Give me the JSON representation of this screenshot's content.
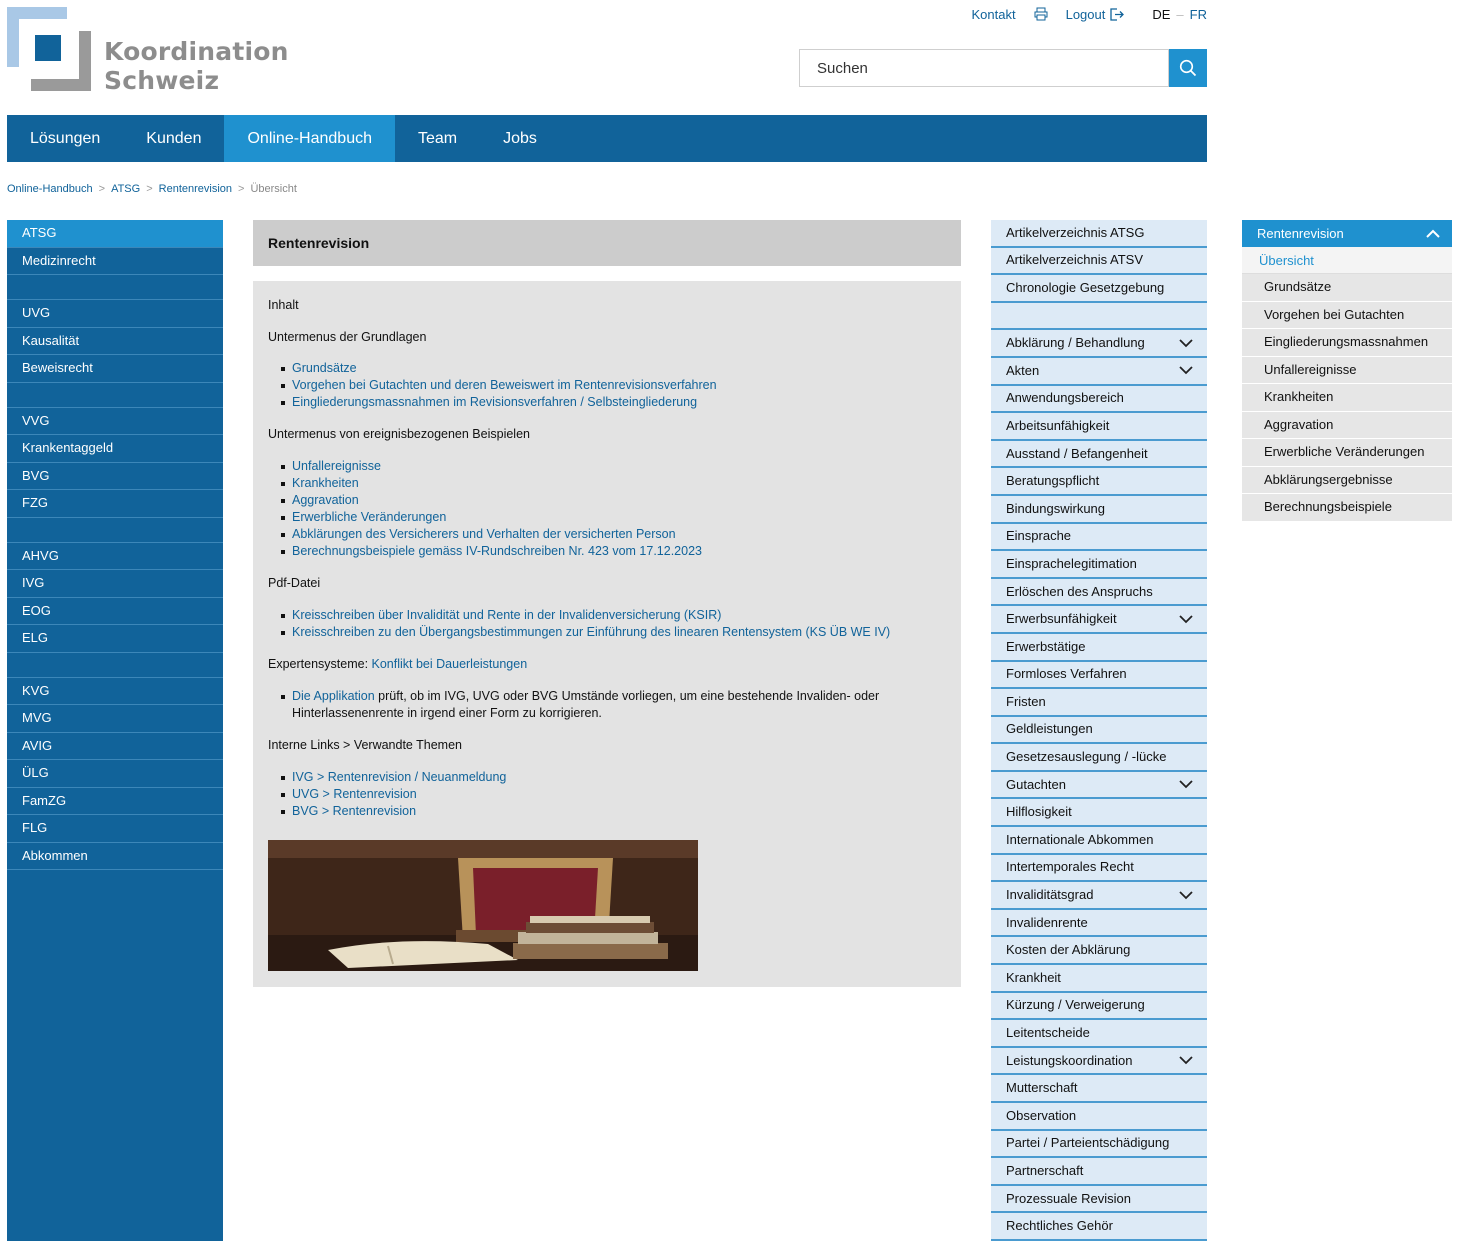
{
  "logo": {
    "line1": "Koordination",
    "line2": "Schweiz"
  },
  "topbar": {
    "contact": "Kontakt",
    "logout": "Logout",
    "lang_de": "DE",
    "lang_sep": "–",
    "lang_fr": "FR"
  },
  "search": {
    "placeholder": "Suchen"
  },
  "mainnav": [
    "Lösungen",
    "Kunden",
    "Online-Handbuch",
    "Team",
    "Jobs"
  ],
  "breadcrumb": {
    "b1": "Online-Handbuch",
    "b2": "ATSG",
    "b3": "Rentenrevision",
    "b4": "Übersicht",
    "sep": ">"
  },
  "leftnav": [
    "ATSG",
    "Medizinrecht",
    "",
    "UVG",
    "Kausalität",
    "Beweisrecht",
    "",
    "VVG",
    "Krankentaggeld",
    "BVG",
    "FZG",
    "",
    "AHVG",
    "IVG",
    "EOG",
    "ELG",
    "",
    "KVG",
    "MVG",
    "AVIG",
    "ÜLG",
    "FamZG",
    "FLG",
    "Abkommen"
  ],
  "content": {
    "title": "Rentenrevision",
    "inhalt": "Inhalt",
    "grundlagen_heading": "Untermenus der Grundlagen",
    "grundlagen": [
      "Grundsätze",
      "Vorgehen bei Gutachten und deren Beweiswert im Rentenrevisionsverfahren",
      "Eingliederungsmassnahmen im Revisionsverfahren / Selbsteingliederung"
    ],
    "beispiele_heading": "Untermenus von ereignisbezogenen Beispielen",
    "beispiele": [
      "Unfallereignisse",
      "Krankheiten",
      "Aggravation",
      "Erwerbliche Veränderungen",
      "Abklärungen des Versicherers und Verhalten der versicherten Person",
      "Berechnungsbeispiele gemäss IV-Rundschreiben Nr. 423 vom 17.12.2023"
    ],
    "pdf_heading": "Pdf-Datei",
    "pdf": [
      "Kreisschreiben über Invalidität und Rente in der Invalidenversicherung (KSIR)",
      "Kreisschreiben zu den Übergangsbestimmungen zur Einführung des linearen Rentensystem (KS ÜB WE IV)"
    ],
    "experten_label": "Expertensysteme: ",
    "experten_link": "Konflikt bei Dauerleistungen",
    "app_link": "Die Applikation",
    "app_text": " prüft, ob im IVG, UVG oder BVG Umstände vorliegen, um eine bestehende Invaliden- oder Hinterlassenenrente in irgend einer Form zu korrigieren.",
    "links_heading": "Interne Links > Verwandte Themen",
    "links": [
      "IVG > Rentenrevision / Neuanmeldung",
      "UVG > Rentenrevision",
      "BVG > Rentenrevision"
    ]
  },
  "artnav": [
    {
      "label": "Artikelverzeichnis ATSG",
      "chev": false
    },
    {
      "label": "Artikelverzeichnis ATSV",
      "chev": false
    },
    {
      "label": "Chronologie Gesetzgebung",
      "chev": false
    },
    {
      "label": "",
      "chev": false
    },
    {
      "label": "Abklärung / Behandlung",
      "chev": true
    },
    {
      "label": "Akten",
      "chev": true
    },
    {
      "label": "Anwendungsbereich",
      "chev": false
    },
    {
      "label": "Arbeitsunfähigkeit",
      "chev": false
    },
    {
      "label": "Ausstand / Befangenheit",
      "chev": false
    },
    {
      "label": "Beratungspflicht",
      "chev": false
    },
    {
      "label": "Bindungswirkung",
      "chev": false
    },
    {
      "label": "Einsprache",
      "chev": false
    },
    {
      "label": "Einsprachelegitimation",
      "chev": false
    },
    {
      "label": "Erlöschen des Anspruchs",
      "chev": false
    },
    {
      "label": "Erwerbsunfähigkeit",
      "chev": true
    },
    {
      "label": "Erwerbstätige",
      "chev": false
    },
    {
      "label": "Formloses Verfahren",
      "chev": false
    },
    {
      "label": "Fristen",
      "chev": false
    },
    {
      "label": "Geldleistungen",
      "chev": false
    },
    {
      "label": "Gesetzesauslegung / -lücke",
      "chev": false
    },
    {
      "label": "Gutachten",
      "chev": true
    },
    {
      "label": "Hilflosigkeit",
      "chev": false
    },
    {
      "label": "Internationale Abkommen",
      "chev": false
    },
    {
      "label": "Intertemporales Recht",
      "chev": false
    },
    {
      "label": "Invaliditätsgrad",
      "chev": true
    },
    {
      "label": "Invalidenrente",
      "chev": false
    },
    {
      "label": "Kosten der Abklärung",
      "chev": false
    },
    {
      "label": "Krankheit",
      "chev": false
    },
    {
      "label": "Kürzung / Verweigerung",
      "chev": false
    },
    {
      "label": "Leitentscheide",
      "chev": false
    },
    {
      "label": "Leistungskoordination",
      "chev": true
    },
    {
      "label": "Mutterschaft",
      "chev": false
    },
    {
      "label": "Observation",
      "chev": false
    },
    {
      "label": "Partei / Parteientschädigung",
      "chev": false
    },
    {
      "label": "Partnerschaft",
      "chev": false
    },
    {
      "label": "Prozessuale Revision",
      "chev": false
    },
    {
      "label": "Rechtliches Gehör",
      "chev": false
    }
  ],
  "subnav": {
    "head": "Rentenrevision",
    "selected": "Übersicht",
    "items": [
      "Grundsätze",
      "Vorgehen bei Gutachten",
      "Eingliederungsmassnahmen",
      "Unfallereignisse",
      "Krankheiten",
      "Aggravation",
      "Erwerbliche Veränderungen",
      "Abklärungsergebnisse",
      "Berechnungsbeispiele"
    ]
  }
}
